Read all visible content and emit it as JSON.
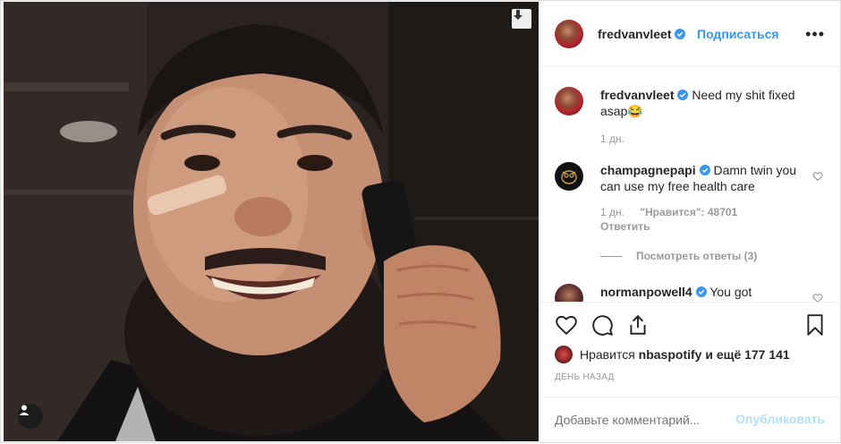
{
  "post": {
    "author": "fredvanvleet",
    "follow_label": "Подписаться",
    "more_label": "•••",
    "caption": {
      "username": "fredvanvleet",
      "text": "Need my shit fixed asap😂",
      "time": "1 дн."
    },
    "comments": [
      {
        "username": "champagnepapi",
        "text": "Damn twin you can use my free health care",
        "time": "1 дн.",
        "likes": "\"Нравится\": 48701",
        "reply_label": "Ответить",
        "view_replies": "Посмотреть ответы (3)"
      },
      {
        "username": "normanpowell4",
        "text": "You got"
      }
    ],
    "likes_prefix": "Нравится",
    "likes_user": "nbaspotify",
    "likes_suffix": "и ещё 177 141",
    "date_label": "ДЕНЬ НАЗАД",
    "add_comment_placeholder": "Добавьте комментарий...",
    "publish_label": "Опубликовать"
  },
  "icons": {
    "download": "download-icon",
    "user_tag": "user-tag-icon",
    "verified": "verified-badge-icon",
    "like": "heart-icon",
    "comment": "comment-icon",
    "share": "share-icon",
    "save": "bookmark-icon"
  },
  "colors": {
    "link_blue": "#3897f0",
    "publish_disabled": "#b2dffc",
    "muted": "#999999",
    "border": "#efefef"
  }
}
